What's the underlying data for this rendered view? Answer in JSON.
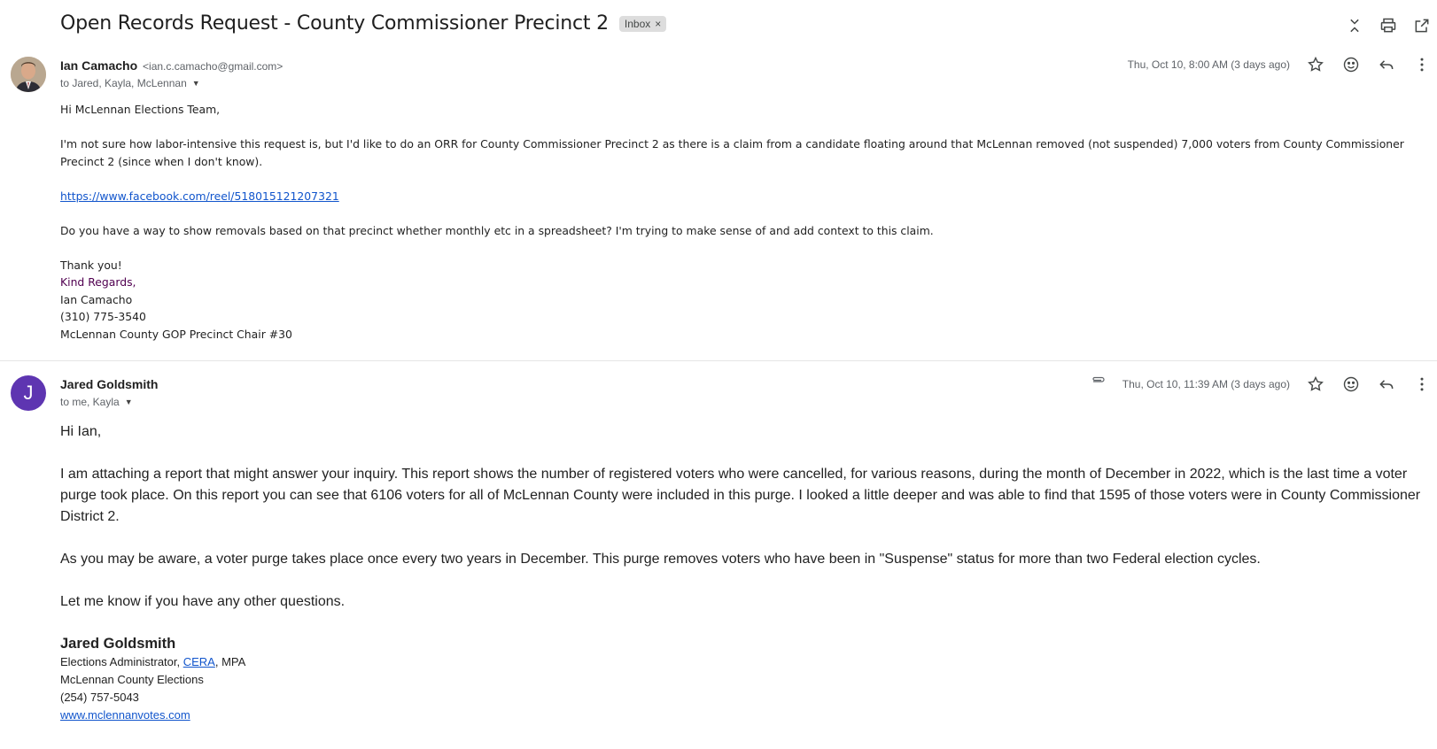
{
  "subject": "Open Records Request - County Commissioner Precinct 2",
  "label": "Inbox",
  "label_close": "×",
  "icons": {
    "collapse": "collapse-all-icon",
    "print": "print-icon",
    "new_window": "open-in-new-window-icon"
  },
  "messages": [
    {
      "sender_name": "Ian Camacho",
      "sender_email": "<ian.c.camacho@gmail.com>",
      "to": "to Jared, Kayla, McLennan",
      "date": "Thu, Oct 10, 8:00 AM (3 days ago)",
      "greeting": "Hi McLennan Elections Team,",
      "para1": "I'm not sure how labor-intensive this request is, but I'd like to do an ORR for County Commissioner Precinct 2 as there is a claim from a candidate floating around that McLennan removed (not suspended) 7,000 voters from County Commissioner Precinct 2 (since when I don't know).",
      "link": "https://www.facebook.com/reel/518015121207321",
      "para2": "Do you have a way to show removals based on that precinct whether monthly etc in a spreadsheet? I'm trying to make sense of and add context to this claim.",
      "thanks": "Thank you!",
      "regards": "Kind Regards,",
      "sig_name": "Ian Camacho",
      "sig_phone": "(310) 775-3540",
      "sig_title": "McLennan County GOP Precinct Chair #30"
    },
    {
      "avatar_letter": "J",
      "sender_name": "Jared Goldsmith",
      "to": "to me, Kayla",
      "date": "Thu, Oct 10, 11:39 AM (3 days ago)",
      "greeting": "Hi Ian,",
      "para1": "I am attaching a report that might answer your inquiry. This report shows the number of registered voters who were cancelled, for various reasons, during the month of December in 2022, which is the last time a voter purge took place. On this report you can see that 6106 voters for all of McLennan County were included in this purge. I looked a little deeper and was able to find that 1595 of those voters were in County Commissioner District 2.",
      "para2": "As you may be aware, a voter purge takes place once every two years in December. This purge removes voters who have been in \"Suspense\" status for more than two Federal election cycles.",
      "para3": "Let me know if you have any other questions.",
      "sig_name": "Jared Goldsmith",
      "sig_title_pre": "Elections Administrator, ",
      "sig_title_link": "CERA",
      "sig_title_post": ", MPA",
      "sig_org": "McLennan County Elections",
      "sig_phone": "(254) 757-5043",
      "sig_web": "www.mclennanvotes.com"
    }
  ]
}
